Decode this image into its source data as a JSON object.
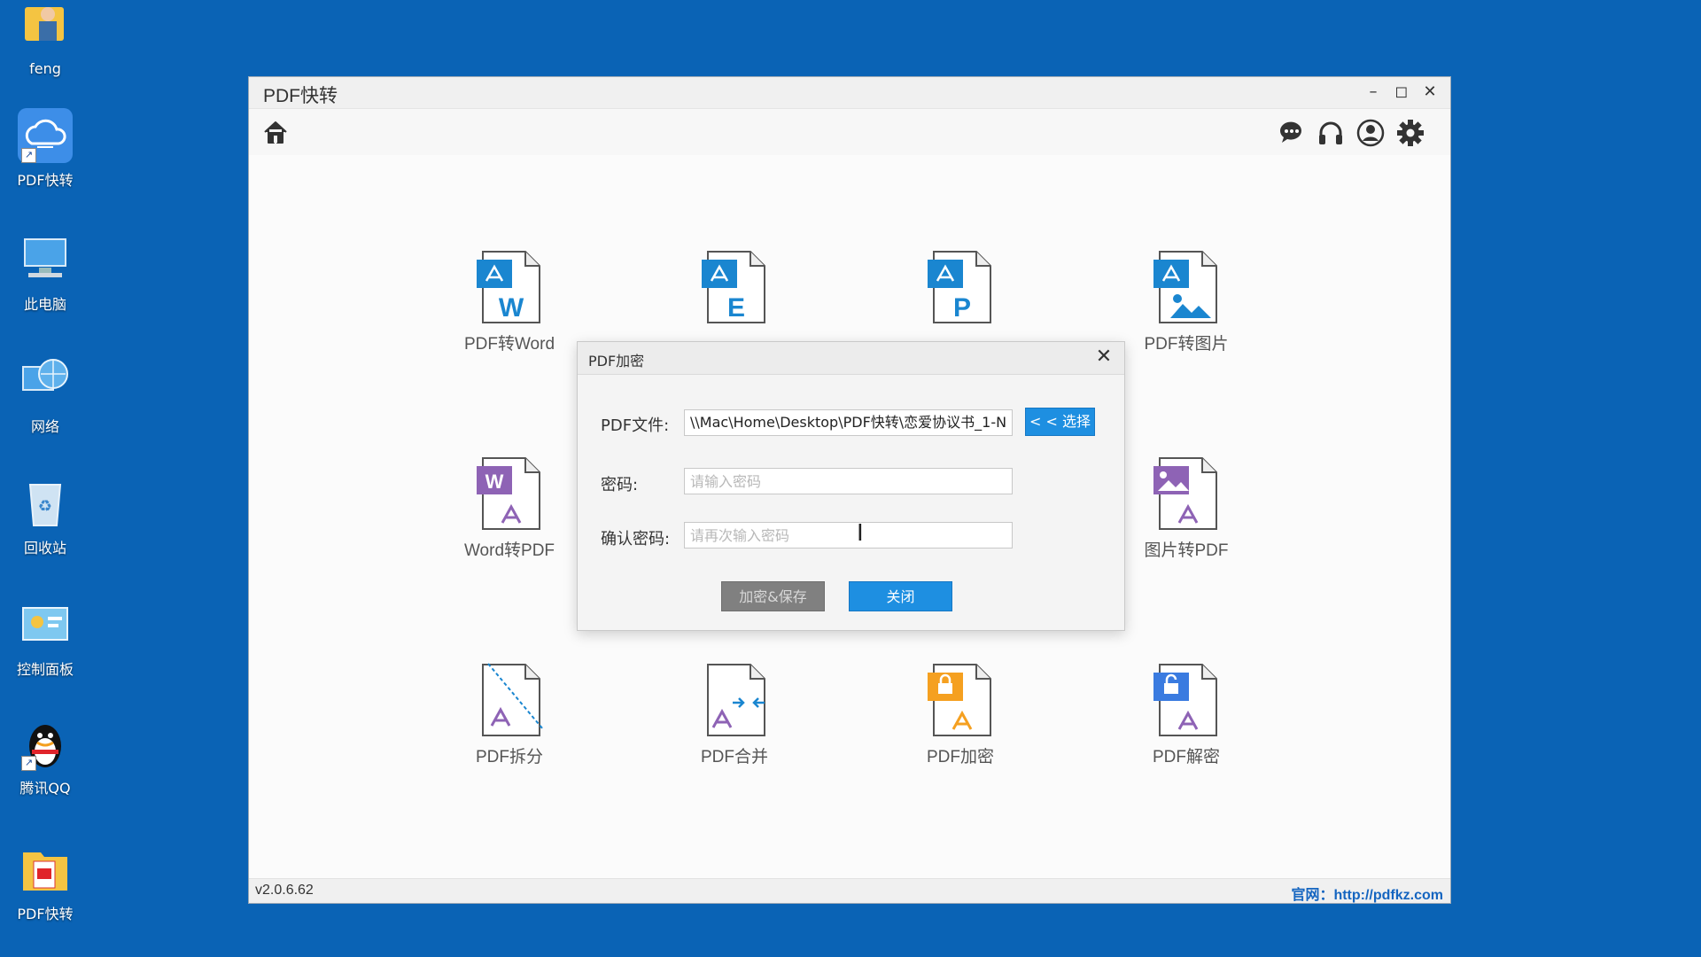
{
  "desktop": {
    "icons": [
      {
        "label": "feng"
      },
      {
        "label": "PDF快转"
      },
      {
        "label": "此电脑"
      },
      {
        "label": "网络"
      },
      {
        "label": "回收站"
      },
      {
        "label": "控制面板"
      },
      {
        "label": "腾讯QQ"
      },
      {
        "label": "PDF快转"
      }
    ]
  },
  "window": {
    "title": "PDF快转",
    "minimize_glyph": "–",
    "maximize_glyph": "◻",
    "close_glyph": "✕",
    "version": "v2.0.6.62",
    "website": "官网：http://pdfkz.com"
  },
  "toolbar": {
    "left": [
      "home-icon"
    ],
    "right": [
      "chat-icon",
      "headset-icon",
      "user-icon",
      "settings-icon"
    ]
  },
  "features": [
    {
      "label": "PDF转Word",
      "icon": "pdf-to-word-icon",
      "badge": "W"
    },
    {
      "label": "",
      "icon": "pdf-to-excel-icon",
      "badge": "E"
    },
    {
      "label": "",
      "icon": "pdf-to-ppt-icon",
      "badge": "P"
    },
    {
      "label": "PDF转图片",
      "icon": "pdf-to-image-icon"
    },
    {
      "label": "Word转PDF",
      "icon": "word-to-pdf-icon",
      "badge": "W"
    },
    {
      "label": "图片转PDF",
      "icon": "image-to-pdf-icon"
    },
    {
      "label": "PDF拆分",
      "icon": "pdf-split-icon"
    },
    {
      "label": "PDF合并",
      "icon": "pdf-merge-icon"
    },
    {
      "label": "PDF加密",
      "icon": "pdf-encrypt-icon"
    },
    {
      "label": "PDF解密",
      "icon": "pdf-decrypt-icon"
    }
  ],
  "dialog": {
    "title": "PDF加密",
    "close_glyph": "✕",
    "file_label": "PDF文件:",
    "file_value": "\\\\Mac\\Home\\Desktop\\PDF快转\\恋爱协议书_1-N",
    "choose_button": "< < 选择",
    "password_label": "密码:",
    "password_placeholder": "请输入密码",
    "confirm_label": "确认密码:",
    "confirm_placeholder": "请再次输入密码",
    "encrypt_button": "加密&保存",
    "close_button": "关闭"
  },
  "colors": {
    "desktop_bg": "#0a63b5",
    "accent_blue": "#1e8fe1",
    "disabled_gray": "#808080",
    "word_purple": "#8e63b5",
    "encrypt_orange": "#f5a020",
    "decrypt_blue": "#3a7be0"
  }
}
